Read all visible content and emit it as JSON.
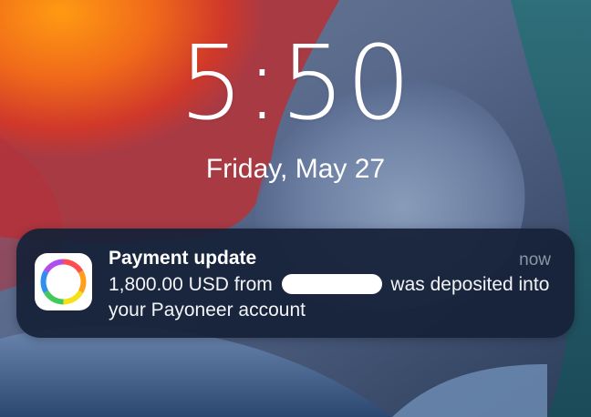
{
  "lockscreen": {
    "time": "5:50",
    "date": "Friday, May 27"
  },
  "notification": {
    "app_icon": "payoneer-ring-icon",
    "title": "Payment update",
    "time": "now",
    "body_before_redaction": "1,800.00 USD from ",
    "body_after_redaction": " was deposited into your Payoneer account"
  },
  "colors": {
    "notification_background": "#162238",
    "time_gray": "#8c95a3"
  }
}
